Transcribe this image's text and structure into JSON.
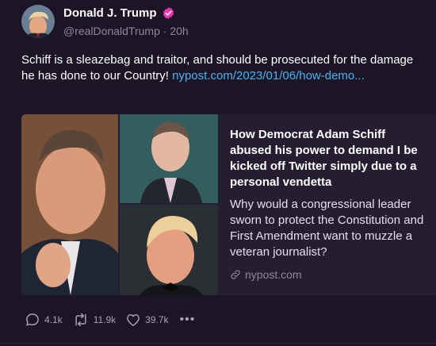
{
  "post": {
    "author_name": "Donald J. Trump",
    "handle": "@realDonaldTrump",
    "separator": " · ",
    "time": "20h",
    "text": "Schiff is a sleazebag and traitor, and should be prosecuted for the damage he has done to our Country! ",
    "link_text": "nypost.com/2023/01/06/how-demo..."
  },
  "card": {
    "title": "How Democrat Adam Schiff abused his power to demand I be kicked off Twitter simply due to a personal vendetta",
    "description": "Why would a congressional leader sworn to protect the Constitution and First Amendment want to muzzle a veteran journalist?",
    "domain": "nypost.com"
  },
  "actions": {
    "replies": "4.1k",
    "reposts": "11.9k",
    "likes": "39.7k",
    "more": "•••"
  },
  "colors": {
    "background": "#1b1525",
    "card": "#251e30",
    "link": "#4ab3f4",
    "verified": "#ea35b1",
    "muted": "#8f879a"
  },
  "icons": [
    "verified-badge-icon",
    "reply-icon",
    "repost-icon",
    "like-icon",
    "more-icon",
    "link-icon"
  ]
}
